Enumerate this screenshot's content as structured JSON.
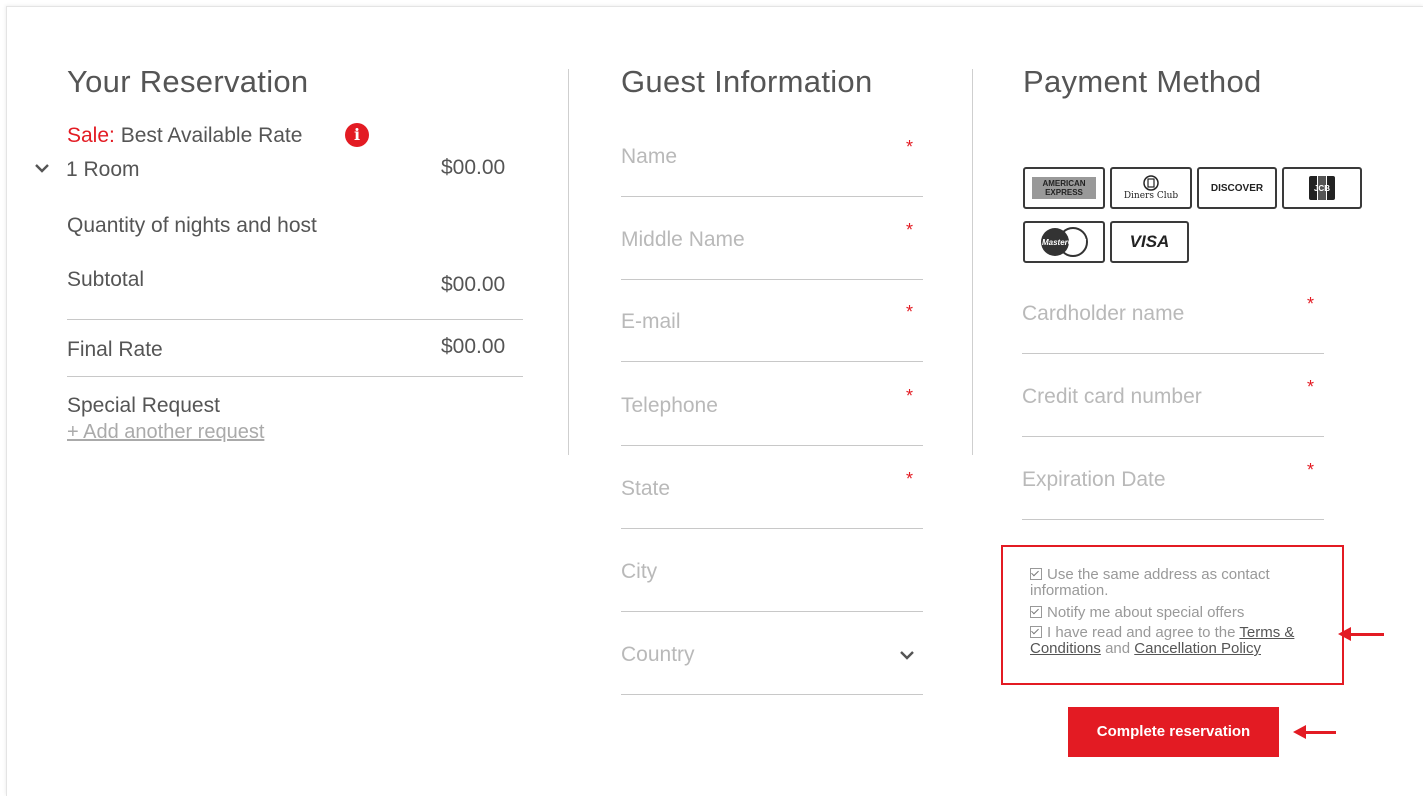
{
  "reservation": {
    "title": "Your Reservation",
    "sale_prefix": "Sale:",
    "rate_name": "Best Available Rate",
    "room_label": "1 Room",
    "room_price": "$00.00",
    "nights_label": "Quantity of nights and host",
    "subtotal_label": "Subtotal",
    "subtotal_value": "$00.00",
    "final_label": "Final Rate",
    "final_value": "$00.00",
    "special_request_label": "Special Request",
    "add_request_link": "+ Add another request"
  },
  "guest": {
    "title": "Guest Information",
    "fields": {
      "name": {
        "placeholder": "Name",
        "required": "*"
      },
      "middle_name": {
        "placeholder": "Middle Name",
        "required": "*"
      },
      "email": {
        "placeholder": "E-mail",
        "required": "*"
      },
      "telephone": {
        "placeholder": "Telephone",
        "required": "*"
      },
      "state": {
        "placeholder": "State",
        "required": "*"
      },
      "city": {
        "placeholder": "City"
      },
      "country": {
        "placeholder": "Country"
      }
    }
  },
  "payment": {
    "title": "Payment Method",
    "cards": {
      "amex": "AMERICAN EXPRESS",
      "diners": "Diners Club",
      "discover": "DISCOVER",
      "jcb": "JCB",
      "mastercard": "MasterCard",
      "visa": "VISA"
    },
    "fields": {
      "cardholder": {
        "placeholder": "Cardholder name",
        "required": "*"
      },
      "card_number": {
        "placeholder": "Credit card number",
        "required": "*"
      },
      "expiration": {
        "placeholder": "Expiration Date",
        "required": "*"
      }
    },
    "checkboxes": {
      "same_address": "Use the same address as contact information.",
      "notify": "Notify me about special offers",
      "agree_prefix": "I have read and agree to the",
      "terms_link": "Terms & Conditions",
      "and_text": "and",
      "cancellation_link": "Cancellation Policy"
    },
    "submit_label": "Complete reservation"
  },
  "colors": {
    "accent": "#e31b23",
    "text": "#555555",
    "placeholder": "#b9b9b9"
  }
}
